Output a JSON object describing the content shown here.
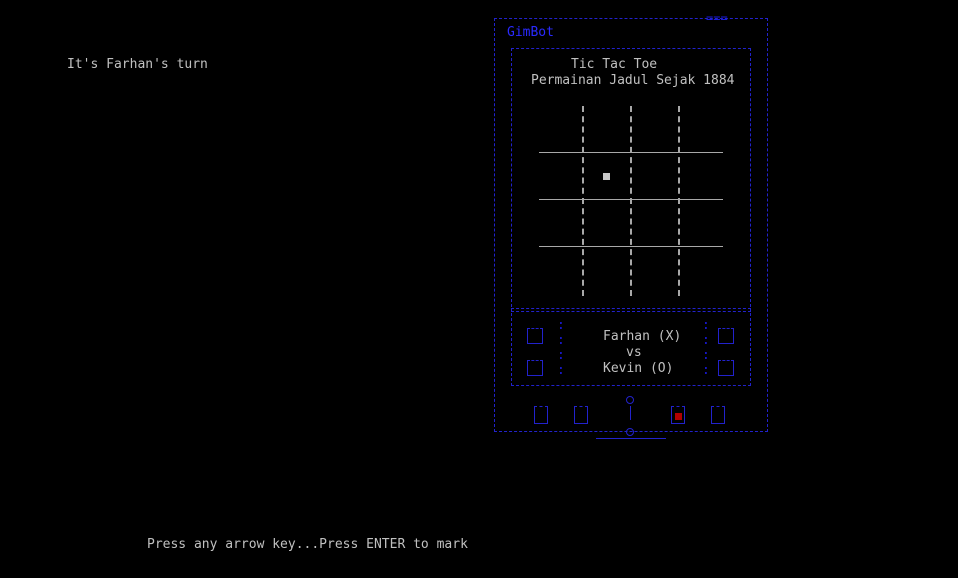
{
  "status": {
    "turn_text": "It's Farhan's turn"
  },
  "device": {
    "brand": "GimBot",
    "top_marks": "===",
    "screen_title": "Tic Tac Toe",
    "screen_subtitle": "Permainan Jadul Sejak 1884"
  },
  "board": {
    "rows": 3,
    "cols": 4,
    "cells": [
      [
        "",
        "",
        "",
        ""
      ],
      [
        "",
        "",
        "",
        ""
      ],
      [
        "",
        "",
        "",
        ""
      ]
    ],
    "cursor": {
      "row": 1,
      "col": 1
    }
  },
  "players": {
    "player1": "Farhan (X)",
    "separator": "vs",
    "player2": "Kevin (O)"
  },
  "hint": {
    "text": "Press any arrow key...Press ENTER to mark"
  },
  "colors": {
    "frame": "#1a1adc",
    "grid": "#a8a8a8",
    "cursor": "#c8c8c8",
    "red_button": "#b00000"
  }
}
